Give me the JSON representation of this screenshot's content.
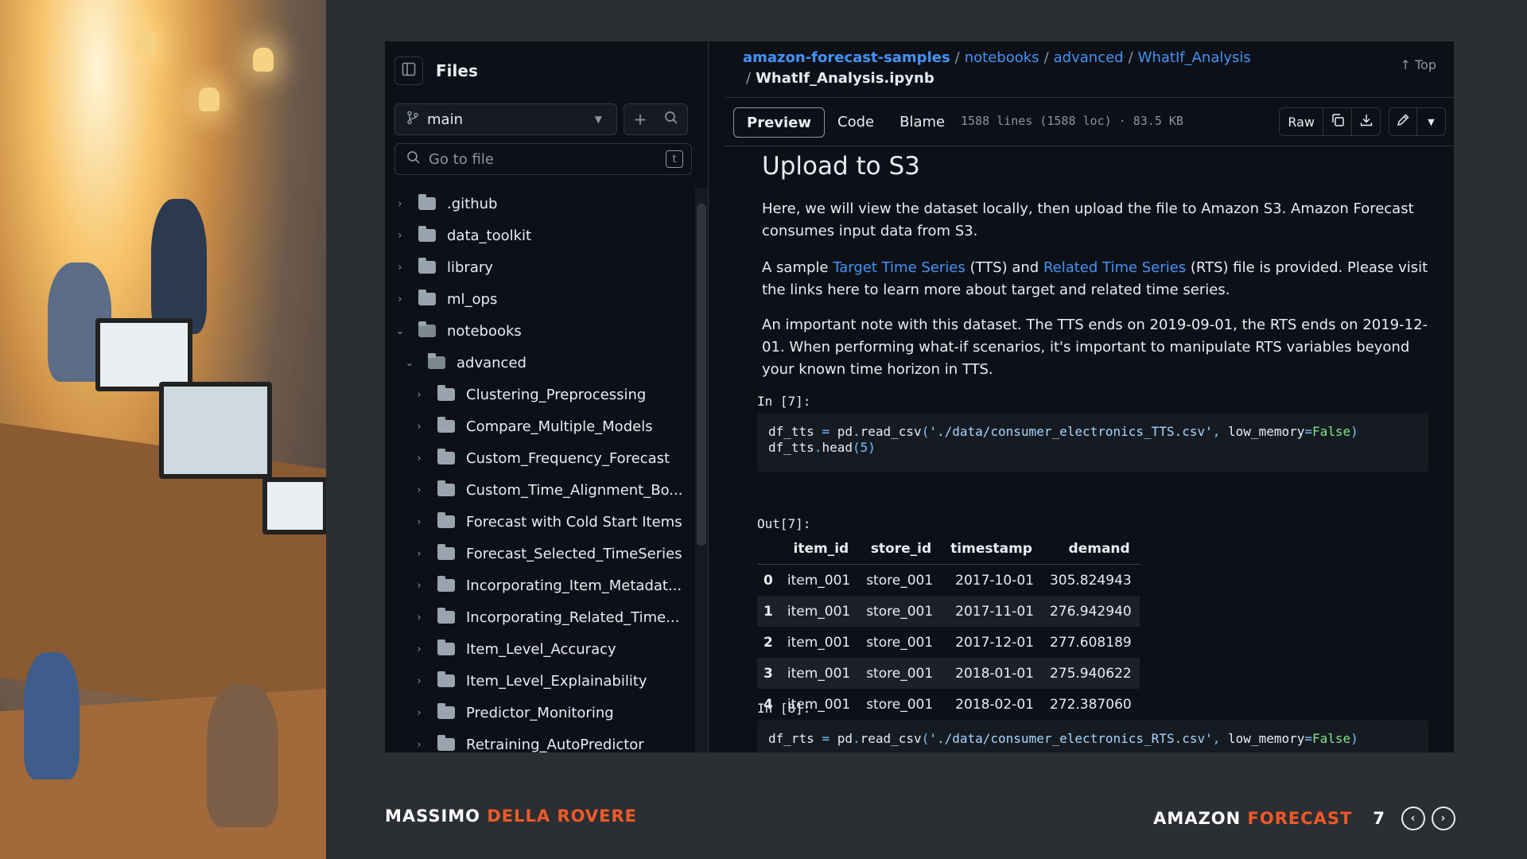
{
  "sidebar": {
    "title": "Files",
    "branch": "main",
    "goto_placeholder": "Go to file",
    "goto_shortcut": "t",
    "items": [
      {
        "label": ".github",
        "open": false,
        "depth": 0
      },
      {
        "label": "data_toolkit",
        "open": false,
        "depth": 0
      },
      {
        "label": "library",
        "open": false,
        "depth": 0
      },
      {
        "label": "ml_ops",
        "open": false,
        "depth": 0
      },
      {
        "label": "notebooks",
        "open": true,
        "depth": 0
      },
      {
        "label": "advanced",
        "open": true,
        "depth": 1
      },
      {
        "label": "Clustering_Preprocessing",
        "open": false,
        "depth": 2
      },
      {
        "label": "Compare_Multiple_Models",
        "open": false,
        "depth": 2
      },
      {
        "label": "Custom_Frequency_Forecast",
        "open": false,
        "depth": 2
      },
      {
        "label": "Custom_Time_Alignment_Bo...",
        "open": false,
        "depth": 2
      },
      {
        "label": "Forecast with Cold Start Items",
        "open": false,
        "depth": 2
      },
      {
        "label": "Forecast_Selected_TimeSeries",
        "open": false,
        "depth": 2
      },
      {
        "label": "Incorporating_Item_Metadat...",
        "open": false,
        "depth": 2
      },
      {
        "label": "Incorporating_Related_Time...",
        "open": false,
        "depth": 2
      },
      {
        "label": "Item_Level_Accuracy",
        "open": false,
        "depth": 2
      },
      {
        "label": "Item_Level_Explainability",
        "open": false,
        "depth": 2
      },
      {
        "label": "Predictor_Monitoring",
        "open": false,
        "depth": 2
      },
      {
        "label": "Retraining_AutoPredictor",
        "open": false,
        "depth": 2
      }
    ]
  },
  "breadcrumb": {
    "repo": "amazon-forecast-samples",
    "parts": [
      "notebooks",
      "advanced",
      "WhatIf_Analysis"
    ],
    "file": "WhatIf_Analysis.ipynb",
    "separator": "/",
    "top_label": "Top"
  },
  "toolbar": {
    "tabs": [
      "Preview",
      "Code",
      "Blame"
    ],
    "active_tab": "Preview",
    "file_info": "1588 lines (1588 loc) · 83.5 KB",
    "raw_label": "Raw"
  },
  "notebook": {
    "heading": "Upload to S3",
    "para1": "Here, we will view the dataset locally, then upload the file to Amazon S3. Amazon Forecast consumes input data from S3.",
    "para2_pre": "A sample ",
    "para2_link1": "Target Time Series",
    "para2_mid": " (TTS) and ",
    "para2_link2": "Related Time Series",
    "para2_post": " (RTS) file is provided. Please visit the links here to learn more about target and related time series.",
    "para3": "An important note with this dataset. The TTS ends on 2019-09-01, the RTS ends on 2019-12-01. When performing what-if scenarios, it's important to manipulate RTS variables beyond your known time horizon in TTS.",
    "in7": "In [7]:",
    "out7": "Out[7]:",
    "in8": "In [8]:",
    "code7": {
      "var": "df_tts",
      "op": "=",
      "mod": "pd",
      "fn": "read_csv",
      "path": "'./data/consumer_electronics_TTS.csv'",
      "kw": "low_memory",
      "val": "False",
      "line2_var": "df_tts",
      "line2_fn": "head",
      "line2_arg": "5"
    },
    "code8": {
      "var": "df_rts",
      "op": "=",
      "mod": "pd",
      "fn": "read_csv",
      "path": "'./data/consumer_electronics_RTS.csv'",
      "kw": "low_memory",
      "val": "False"
    },
    "table": {
      "columns": [
        "",
        "item_id",
        "store_id",
        "timestamp",
        "demand"
      ],
      "rows": [
        [
          "0",
          "item_001",
          "store_001",
          "2017-10-01",
          "305.824943"
        ],
        [
          "1",
          "item_001",
          "store_001",
          "2017-11-01",
          "276.942940"
        ],
        [
          "2",
          "item_001",
          "store_001",
          "2017-12-01",
          "277.608189"
        ],
        [
          "3",
          "item_001",
          "store_001",
          "2018-01-01",
          "275.940622"
        ],
        [
          "4",
          "item_001",
          "store_001",
          "2018-02-01",
          "272.387060"
        ]
      ]
    }
  },
  "footer": {
    "author_first": "MASSIMO",
    "author_last": "DELLA ROVERE",
    "brand_first": "AMAZON",
    "brand_second": "FORECAST",
    "page": "7"
  },
  "colors": {
    "accent": "#f05a28",
    "link": "#4493f8",
    "background": "#2b2f33"
  }
}
